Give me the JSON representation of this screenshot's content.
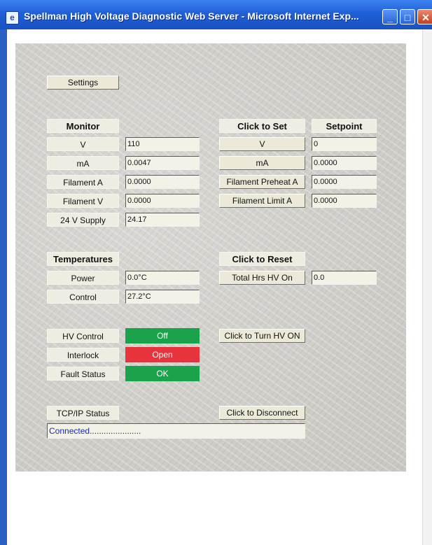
{
  "window": {
    "title": "Spellman High Voltage Diagnostic Web Server - Microsoft Internet Exp...",
    "minimize": "_",
    "maximize": "□",
    "close": "✕"
  },
  "settings_label": "Settings",
  "monitor": {
    "header": "Monitor",
    "rows": [
      {
        "label": "V",
        "value": "110"
      },
      {
        "label": "mA",
        "value": "0.0047"
      },
      {
        "label": "Filament A",
        "value": "0.0000"
      },
      {
        "label": "Filament V",
        "value": "0.0000"
      },
      {
        "label": "24 V Supply",
        "value": "24.17"
      }
    ]
  },
  "set": {
    "header": "Click to Set",
    "setpoint_header": "Setpoint",
    "rows": [
      {
        "label": "V",
        "value": "0"
      },
      {
        "label": "mA",
        "value": "0.0000"
      },
      {
        "label": "Filament Preheat A",
        "value": "0.0000"
      },
      {
        "label": "Filament Limit A",
        "value": "0.0000"
      }
    ]
  },
  "temperatures": {
    "header": "Temperatures",
    "rows": [
      {
        "label": "Power",
        "value": "0.0°C"
      },
      {
        "label": "Control",
        "value": "27.2°C"
      }
    ]
  },
  "reset": {
    "header": "Click to Reset",
    "label": "Total Hrs HV On",
    "value": "0.0"
  },
  "status": {
    "hv_control": {
      "label": "HV Control",
      "value": "Off",
      "color": "#1aa34a"
    },
    "interlock": {
      "label": "Interlock",
      "value": "Open",
      "color": "#e8333d"
    },
    "fault": {
      "label": "Fault Status",
      "value": "OK",
      "color": "#1aa34a"
    },
    "hv_on_button": "Click to Turn HV ON"
  },
  "tcp": {
    "label": "TCP/IP Status",
    "disconnect_button": "Click to Disconnect",
    "connection": "Connected......................"
  }
}
